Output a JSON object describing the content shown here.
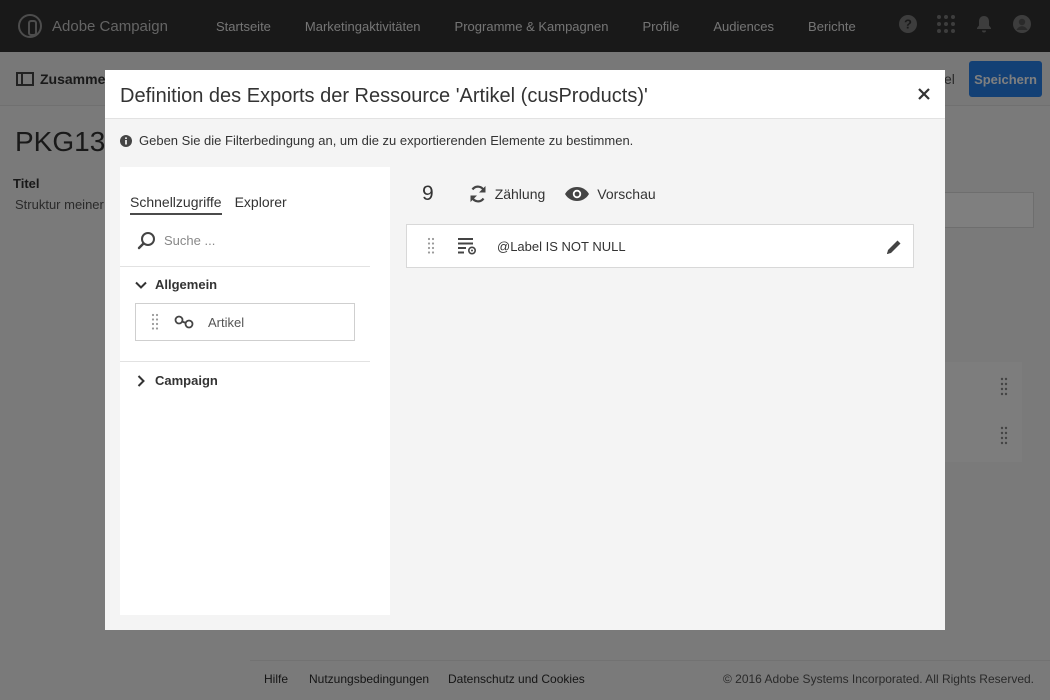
{
  "header": {
    "brand": "Adobe Campaign",
    "nav": [
      "Startseite",
      "Marketingaktivitäten",
      "Programme & Kampagnen",
      "Profile",
      "Audiences",
      "Berichte"
    ],
    "icons": [
      "help-icon",
      "apps-grid-icon",
      "bell-icon",
      "user-avatar-icon"
    ]
  },
  "background": {
    "breadcrumb_label": "Zusamme",
    "cancel_fragment": "el",
    "save_label": "Speichern",
    "title": "PKG13",
    "field_label": "Titel",
    "field_value": "Struktur meiner",
    "footer": {
      "help": "Hilfe",
      "terms": "Nutzungsbedingungen",
      "privacy": "Datenschutz und Cookies",
      "copyright": "© 2016 Adobe Systems Incorporated. All Rights Reserved."
    }
  },
  "modal": {
    "title": "Definition des Exports der Ressource 'Artikel (cusProducts)'",
    "info": "Geben Sie die Filterbedingung an, um die zu exportierenden Elemente zu bestimmen.",
    "tabs": [
      "Schnellzugriffe",
      "Explorer"
    ],
    "search_placeholder": "Suche ...",
    "groups": {
      "general": "Allgemein",
      "campaign": "Campaign"
    },
    "tree_item": "Artikel",
    "count": "9",
    "count_label": "Zählung",
    "preview_label": "Vorschau",
    "rule_expression": "@Label IS NOT NULL",
    "colors": {
      "accent": "#2680eb",
      "topbar": "#323232",
      "overlay": "rgba(0,0,0,0.5)"
    }
  }
}
